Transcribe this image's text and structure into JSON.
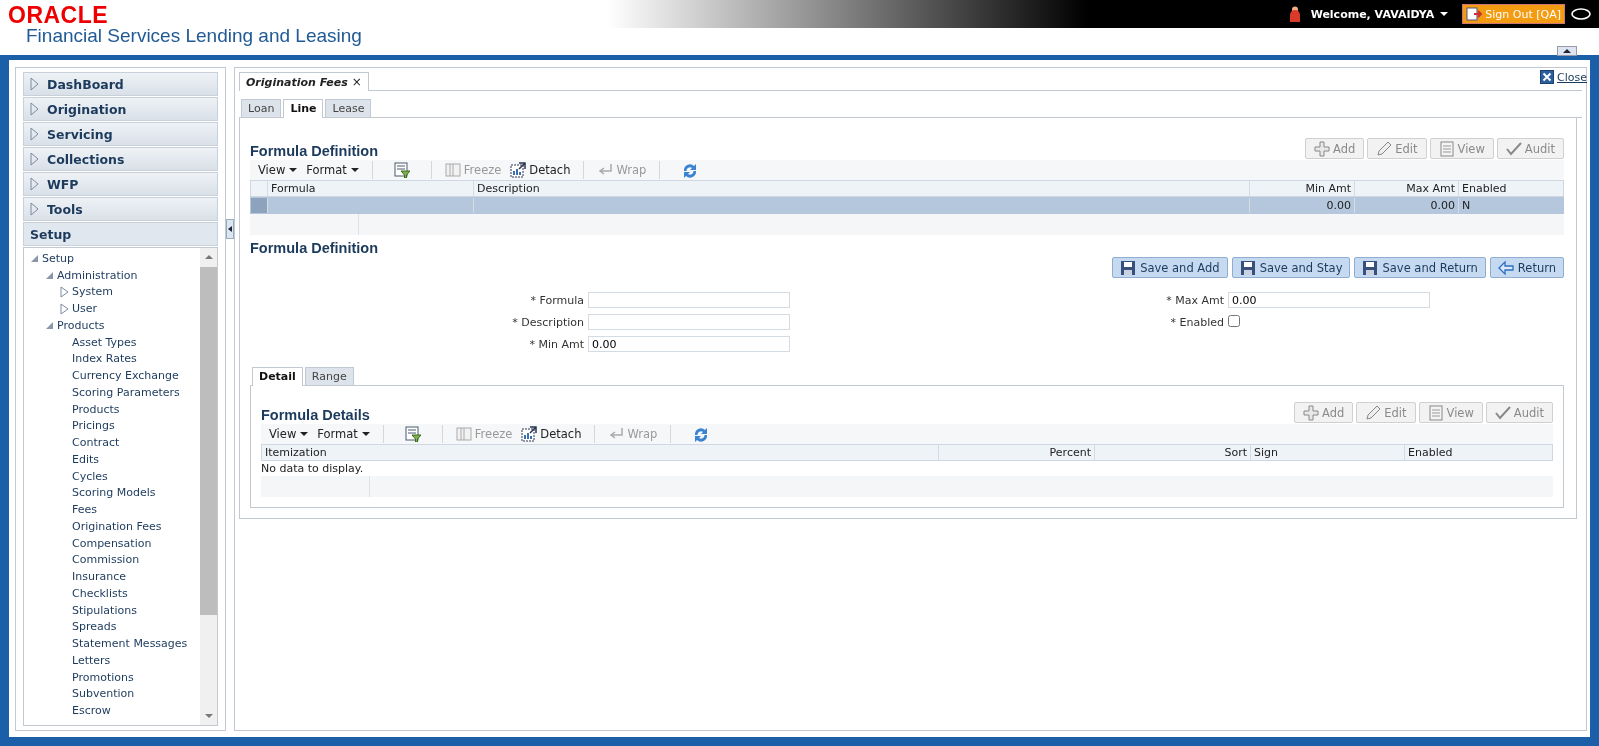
{
  "header": {
    "logo": "ORACLE",
    "product": "Financial Services Lending and Leasing",
    "welcome": "Welcome, VAVAIDYA",
    "sign_out": "Sign Out [QA]"
  },
  "navigator": {
    "sections": [
      {
        "label": "DashBoard",
        "expanded": false
      },
      {
        "label": "Origination",
        "expanded": false
      },
      {
        "label": "Servicing",
        "expanded": false
      },
      {
        "label": "Collections",
        "expanded": false
      },
      {
        "label": "WFP",
        "expanded": false
      },
      {
        "label": "Tools",
        "expanded": false
      },
      {
        "label": "Setup",
        "expanded": true
      }
    ],
    "tree": [
      {
        "label": "Setup",
        "expanded": true,
        "children": [
          {
            "label": "Administration",
            "expanded": true,
            "children": [
              {
                "label": "System",
                "expanded": false
              },
              {
                "label": "User",
                "expanded": false
              }
            ]
          },
          {
            "label": "Products",
            "expanded": true,
            "children": [
              {
                "label": "Asset Types"
              },
              {
                "label": "Index Rates"
              },
              {
                "label": "Currency Exchange"
              },
              {
                "label": "Scoring Parameters"
              },
              {
                "label": "Products"
              },
              {
                "label": "Pricings"
              },
              {
                "label": "Contract"
              },
              {
                "label": "Edits"
              },
              {
                "label": "Cycles"
              },
              {
                "label": "Scoring Models"
              },
              {
                "label": "Fees"
              },
              {
                "label": "Origination Fees"
              },
              {
                "label": "Compensation"
              },
              {
                "label": "Commission"
              },
              {
                "label": "Insurance"
              },
              {
                "label": "Checklists"
              },
              {
                "label": "Stipulations"
              },
              {
                "label": "Spreads"
              },
              {
                "label": "Statement Messages"
              },
              {
                "label": "Letters"
              },
              {
                "label": "Promotions"
              },
              {
                "label": "Subvention"
              },
              {
                "label": "Escrow"
              }
            ]
          }
        ]
      }
    ]
  },
  "document_tabs": [
    {
      "label": "Origination Fees",
      "close": "×",
      "selected": true
    }
  ],
  "close_link": "Close",
  "product_tabs": [
    {
      "label": "Loan",
      "selected": false
    },
    {
      "label": "Line",
      "selected": true
    },
    {
      "label": "Lease",
      "selected": false
    }
  ],
  "formula_definition": {
    "title": "Formula Definition",
    "actions": [
      {
        "kind": "add",
        "label": "Add",
        "disabled": true
      },
      {
        "kind": "edit",
        "label": "Edit",
        "disabled": true
      },
      {
        "kind": "view",
        "label": "View",
        "disabled": true
      },
      {
        "kind": "audit",
        "label": "Audit",
        "disabled": true
      }
    ],
    "toolbar": [
      {
        "kind": "menu",
        "label": "View"
      },
      {
        "kind": "menu",
        "label": "Format"
      },
      {
        "kind": "filter"
      },
      {
        "kind": "freeze",
        "label": "Freeze",
        "disabled": true
      },
      {
        "kind": "detach",
        "label": "Detach",
        "disabled": false
      },
      {
        "kind": "wrap",
        "label": "Wrap",
        "disabled": true
      },
      {
        "kind": "refresh"
      }
    ],
    "table": {
      "columns": [
        {
          "label": "Formula",
          "kind": "text"
        },
        {
          "label": "Description",
          "kind": "text"
        },
        {
          "label": "Min Amt",
          "kind": "number"
        },
        {
          "label": "Max Amt",
          "kind": "number"
        },
        {
          "label": "Enabled",
          "kind": "text"
        }
      ],
      "rows": [
        {
          "cells": [
            null,
            null,
            "0.00",
            "0.00",
            "N"
          ],
          "selected": true
        }
      ]
    }
  },
  "form": {
    "title": "Formula Definition",
    "buttons": [
      {
        "kind": "save",
        "label": "Save and Add"
      },
      {
        "kind": "save",
        "label": "Save and Stay"
      },
      {
        "kind": "save",
        "label": "Save and Return"
      },
      {
        "kind": "return",
        "label": "Return"
      }
    ],
    "left_fields": [
      {
        "kind": "text",
        "label": "* Formula"
      },
      {
        "kind": "text",
        "label": "* Description"
      },
      {
        "kind": "text",
        "label": "* Min Amt",
        "value": "0.00"
      }
    ],
    "right_fields": [
      {
        "kind": "text",
        "label": "* Max Amt",
        "value": "0.00"
      },
      {
        "kind": "checkbox",
        "label": "* Enabled",
        "checked": false
      }
    ]
  },
  "detail_tabs": [
    {
      "label": "Detail",
      "selected": true
    },
    {
      "label": "Range",
      "selected": false
    }
  ],
  "formula_details": {
    "title": "Formula Details",
    "actions": [
      {
        "kind": "add",
        "label": "Add",
        "disabled": true
      },
      {
        "kind": "edit",
        "label": "Edit",
        "disabled": true
      },
      {
        "kind": "view",
        "label": "View",
        "disabled": true
      },
      {
        "kind": "audit",
        "label": "Audit",
        "disabled": true
      }
    ],
    "toolbar": [
      {
        "kind": "menu",
        "label": "View"
      },
      {
        "kind": "menu",
        "label": "Format"
      },
      {
        "kind": "filter"
      },
      {
        "kind": "freeze",
        "label": "Freeze",
        "disabled": true
      },
      {
        "kind": "detach",
        "label": "Detach",
        "disabled": false
      },
      {
        "kind": "wrap",
        "label": "Wrap",
        "disabled": true
      },
      {
        "kind": "refresh"
      }
    ],
    "table": {
      "columns": [
        {
          "label": "Itemization",
          "kind": "text"
        },
        {
          "label": "Percent",
          "kind": "number"
        },
        {
          "label": "Sort",
          "kind": "number"
        },
        {
          "label": "Sign",
          "kind": "text"
        },
        {
          "label": "Enabled",
          "kind": "text"
        }
      ],
      "empty_text": "No data to display."
    }
  }
}
